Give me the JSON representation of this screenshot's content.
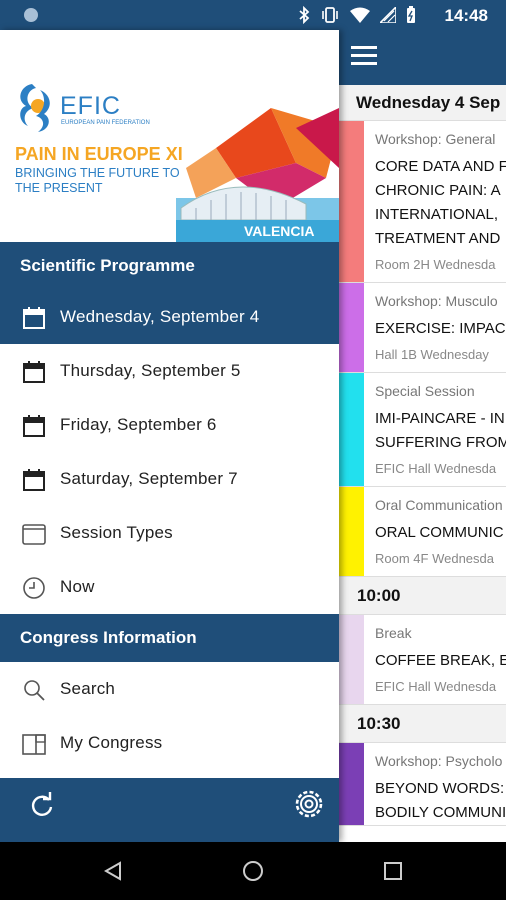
{
  "status_bar": {
    "time": "14:48",
    "icons": [
      "bluetooth-icon",
      "vibrate-icon",
      "wifi-icon",
      "signal-icon",
      "battery-icon"
    ]
  },
  "drawer": {
    "banner": {
      "brand": "EFIC",
      "brand_sub": "EUROPEAN PAIN FEDERATION",
      "headline": "PAIN IN EUROPE XI",
      "tagline": "BRINGING THE FUTURE TO THE PRESENT",
      "art_label": "VALENCIA"
    },
    "scientific_programme": {
      "title": "Scientific Programme",
      "items": [
        {
          "label": "Wednesday, September 4",
          "icon": "calendar-icon",
          "active": true
        },
        {
          "label": "Thursday, September 5",
          "icon": "calendar-icon",
          "active": false
        },
        {
          "label": "Friday, September 6",
          "icon": "calendar-icon",
          "active": false
        },
        {
          "label": "Saturday, September 7",
          "icon": "calendar-icon",
          "active": false
        },
        {
          "label": "Session Types",
          "icon": "window-icon",
          "active": false
        },
        {
          "label": "Now",
          "icon": "clock-icon",
          "active": false
        }
      ]
    },
    "congress_information": {
      "title": "Congress Information",
      "items": [
        {
          "label": "Search",
          "icon": "search-icon"
        },
        {
          "label": "My Congress",
          "icon": "book-icon"
        }
      ]
    },
    "footer": {
      "refresh_icon": "refresh-icon",
      "settings_icon": "gear-icon"
    }
  },
  "content": {
    "day_header": "Wednesday 4 Sep",
    "sessions": [
      {
        "type": "Workshop: General",
        "title_lines": [
          "CORE DATA AND F",
          "CHRONIC PAIN: A",
          "INTERNATIONAL,",
          "TREATMENT AND"
        ],
        "room": "Room 2H Wednesda",
        "color": "#f47c7c"
      },
      {
        "type": "Workshop: Musculo",
        "title_lines": [
          "EXERCISE: IMPACT"
        ],
        "room": "Hall 1B Wednesday",
        "color": "#cc6ee8"
      },
      {
        "type": "Special Session",
        "title_lines": [
          "IMI-PAINCARE - IN",
          "SUFFERING FROM"
        ],
        "room": "EFIC Hall Wednesda",
        "color": "#22e0ee"
      },
      {
        "type": "Oral Communication",
        "title_lines": [
          "ORAL COMMUNIC"
        ],
        "room": "Room 4F Wednesda",
        "color": "#fff200"
      }
    ],
    "time_1": "10:00",
    "sessions_2": [
      {
        "type": "Break",
        "title_lines": [
          "COFFEE BREAK, EX"
        ],
        "room": "EFIC Hall Wednesda",
        "color": "#e8d6ee"
      }
    ],
    "time_2": "10:30",
    "sessions_3": [
      {
        "type": "Workshop: Psycholo",
        "title_lines": [
          "BEYOND WORDS:",
          "BODILY COMMUNI"
        ],
        "room": "",
        "color": "#7b3fb5"
      }
    ]
  },
  "colors": {
    "primary": "#1f4e79",
    "accent": "#f5a623",
    "brand_blue": "#2c7fc4"
  }
}
